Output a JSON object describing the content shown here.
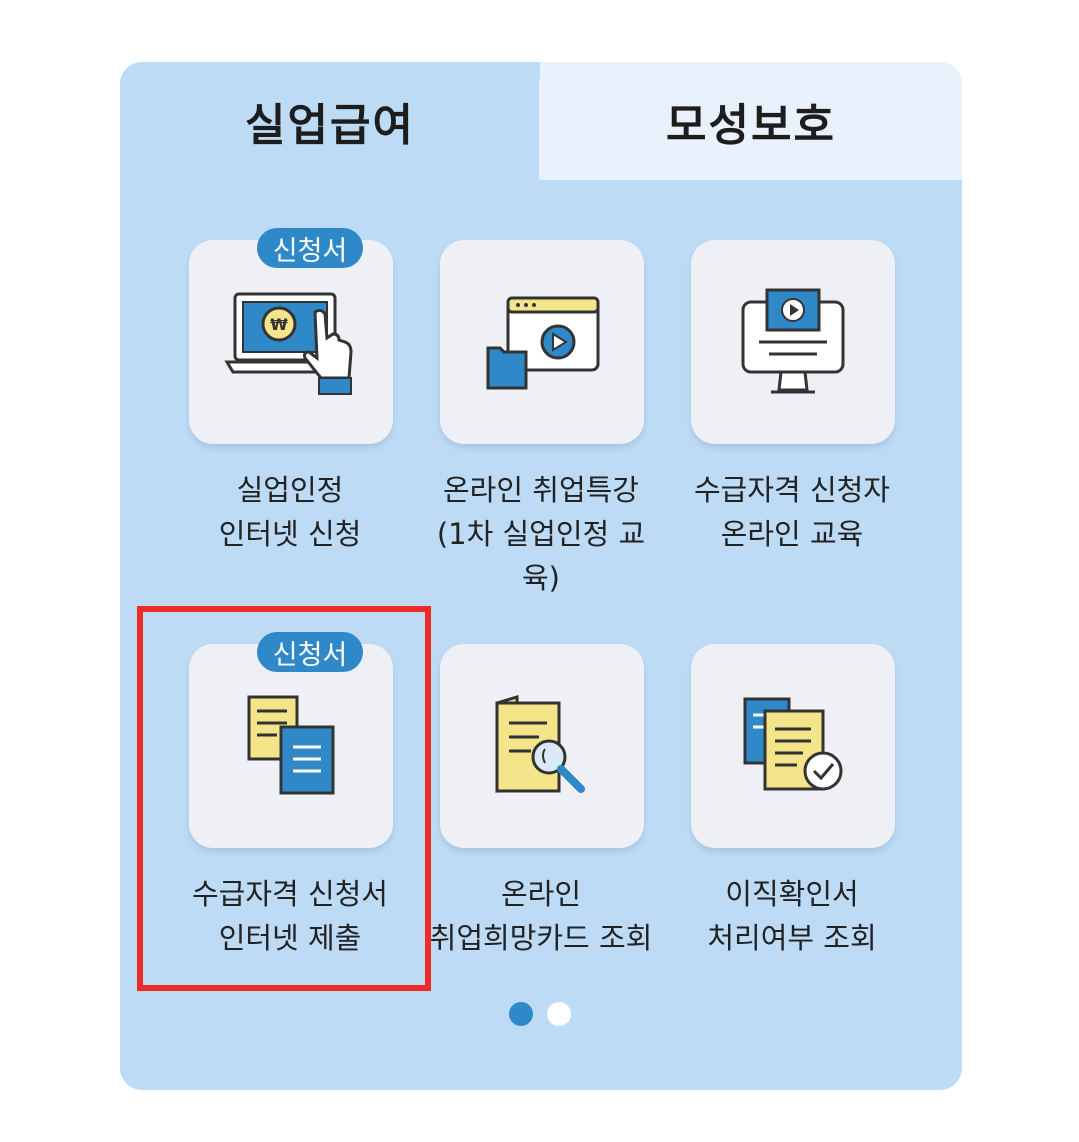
{
  "tabs": [
    {
      "label": "실업급여",
      "active": true
    },
    {
      "label": "모성보호",
      "active": false
    }
  ],
  "items": [
    {
      "badge": "신청서",
      "lines": [
        "실업인정",
        "인터넷 신청"
      ],
      "icon": "online-payment-icon"
    },
    {
      "badge": "",
      "lines": [
        "온라인 취업특강",
        "(1차 실업인정 교",
        "육)"
      ],
      "icon": "video-lecture-icon"
    },
    {
      "badge": "",
      "lines": [
        "수급자격 신청자",
        "온라인 교육"
      ],
      "icon": "monitor-video-icon"
    },
    {
      "badge": "신청서",
      "lines": [
        "수급자격 신청서",
        "인터넷 제출"
      ],
      "icon": "documents-icon"
    },
    {
      "badge": "",
      "lines": [
        "온라인",
        "취업희망카드 조회"
      ],
      "icon": "document-search-icon"
    },
    {
      "badge": "",
      "lines": [
        "이직확인서",
        "처리여부 조회"
      ],
      "icon": "document-check-icon"
    }
  ],
  "pagination": {
    "total": 2,
    "current": 1
  },
  "colors": {
    "accent": "#2f88c8",
    "panel": "#bddbf5",
    "highlight": "#ee2b24"
  }
}
